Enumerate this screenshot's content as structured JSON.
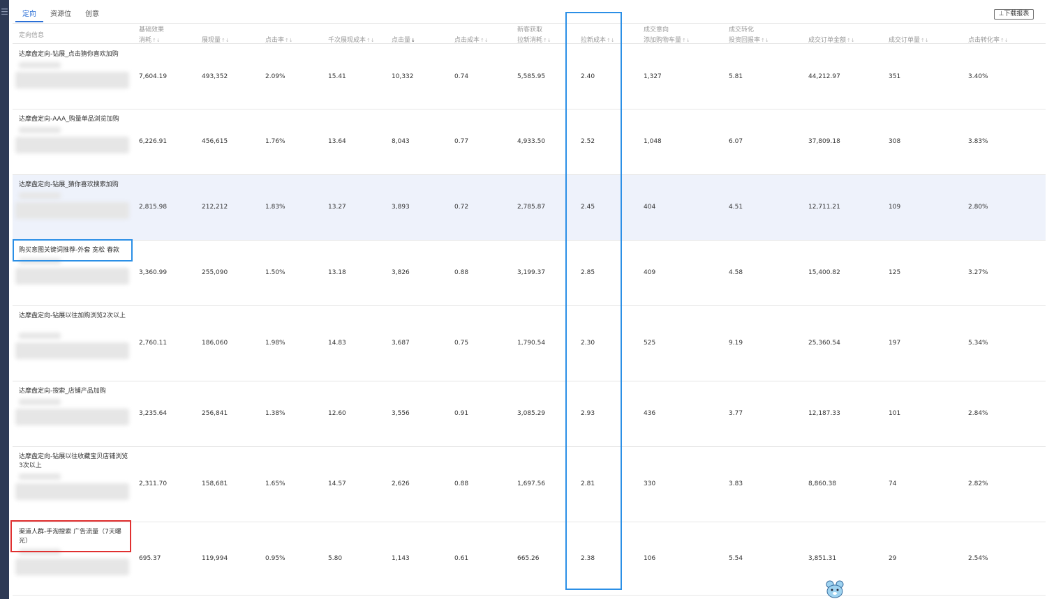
{
  "tabs": [
    "定向",
    "资源位",
    "创意"
  ],
  "download_label": "⊥下载报表",
  "header_groups": [
    {
      "label": "基础效果",
      "col": 1
    },
    {
      "label": "新客获取",
      "col": 7
    },
    {
      "label": "成交意向",
      "col": 9
    },
    {
      "label": "成交转化",
      "col": 10
    }
  ],
  "columns": [
    "定向信息",
    "消耗",
    "展现量",
    "点击率",
    "千次展现成本",
    "点击量",
    "点击成本",
    "拉新消耗",
    "拉新成本",
    "添加购物车量",
    "投资回报率",
    "成交订单金额",
    "成交订单量",
    "点击转化率"
  ],
  "rows": [
    {
      "name": "达摩盘定向-钻展_点击猜你喜欢加购",
      "values": [
        "7,604.19",
        "493,352",
        "2.09%",
        "15.41",
        "10,332",
        "0.74",
        "5,585.95",
        "2.40",
        "1,327",
        "5.81",
        "44,212.97",
        "351",
        "3.40%"
      ]
    },
    {
      "name": "达摩盘定向-AAA_购量单品浏览加购",
      "values": [
        "6,226.91",
        "456,615",
        "1.76%",
        "13.64",
        "8,043",
        "0.77",
        "4,933.50",
        "2.52",
        "1,048",
        "6.07",
        "37,809.18",
        "308",
        "3.83%"
      ]
    },
    {
      "name": "达摩盘定向-钻展_猜你喜欢搜索加购",
      "values": [
        "2,815.98",
        "212,212",
        "1.83%",
        "13.27",
        "3,893",
        "0.72",
        "2,785.87",
        "2.45",
        "404",
        "4.51",
        "12,711.21",
        "109",
        "2.80%"
      ]
    },
    {
      "name": "购买意图关键词推荐-外套 宽松 春款",
      "values": [
        "3,360.99",
        "255,090",
        "1.50%",
        "13.18",
        "3,826",
        "0.88",
        "3,199.37",
        "2.85",
        "409",
        "4.58",
        "15,400.82",
        "125",
        "3.27%"
      ]
    },
    {
      "name": "达摩盘定向-钻展以往加购浏览2次以上",
      "values": [
        "2,760.11",
        "186,060",
        "1.98%",
        "14.83",
        "3,687",
        "0.75",
        "1,790.54",
        "2.30",
        "525",
        "9.19",
        "25,360.54",
        "197",
        "5.34%"
      ]
    },
    {
      "name": "达摩盘定向-搜索_店铺产品加购",
      "values": [
        "3,235.64",
        "256,841",
        "1.38%",
        "12.60",
        "3,556",
        "0.91",
        "3,085.29",
        "2.93",
        "436",
        "3.77",
        "12,187.33",
        "101",
        "2.84%"
      ]
    },
    {
      "name": "达摩盘定向-钻展以往收藏宝贝店铺浏览3次以上",
      "values": [
        "2,311.70",
        "158,681",
        "1.65%",
        "14.57",
        "2,626",
        "0.88",
        "1,697.56",
        "2.81",
        "330",
        "3.83",
        "8,860.38",
        "74",
        "2.82%"
      ]
    },
    {
      "name": "渠道人群-手淘搜索 广告流量（7天曝光）",
      "values": [
        "695.37",
        "119,994",
        "0.95%",
        "5.80",
        "1,143",
        "0.61",
        "665.26",
        "2.38",
        "106",
        "5.54",
        "3,851.31",
        "29",
        "2.54%"
      ]
    }
  ]
}
